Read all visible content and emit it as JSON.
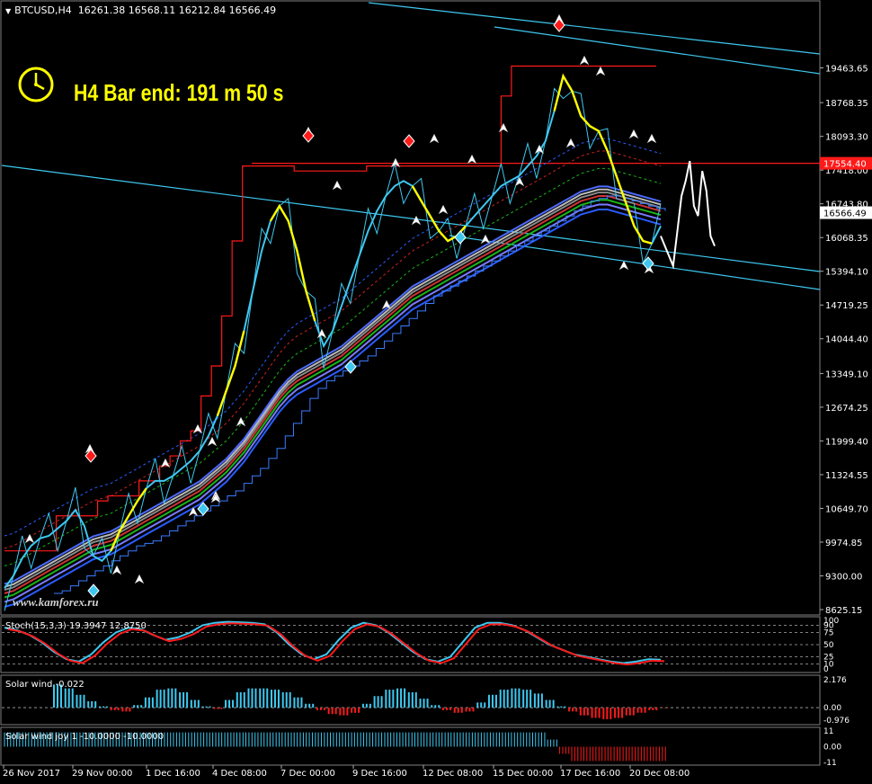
{
  "header": {
    "symbol_tf": "BTCUSD,H4",
    "ohlc": "16261.38 16568.11 16212.84 16566.49"
  },
  "bar_timer": "H4 Bar end: 191 m 50 s",
  "watermark": "www.kamforex.ru",
  "colors": {
    "bg": "#000000",
    "grid": "#3a3a3a",
    "red": "#ff1a1a",
    "cyan": "#3ec8f0",
    "yellow": "#ffff00",
    "white": "#ffffff",
    "blue": "#2a5cff",
    "green": "#19b419"
  },
  "chart_data": [
    {
      "type": "line",
      "title": "BTCUSD,H4",
      "ylim": [
        8625.15,
        20138.0
      ],
      "y_ticks": [
        "19463.65",
        "18768.35",
        "18093.30",
        "17418.00",
        "16743.80",
        "16068.35",
        "15394.10",
        "14719.25",
        "14044.40",
        "13349.10",
        "12674.25",
        "11999.40",
        "11324.55",
        "10649.70",
        "9974.85",
        "9300.00",
        "8625.15"
      ],
      "x_ticks": [
        "26 Nov 2017",
        "29 Nov 00:00",
        "1 Dec 16:00",
        "4 Dec 08:00",
        "7 Dec 00:00",
        "9 Dec 16:00",
        "12 Dec 08:00",
        "15 Dec 00:00",
        "17 Dec 16:00",
        "20 Dec 08:00"
      ],
      "current_price": "16566.49",
      "resistance_level": "17554.40",
      "series": [
        {
          "values": [
            9050,
            9300,
            9650,
            9900,
            10050,
            10100,
            10250,
            10400,
            10620,
            10300,
            9700,
            9600,
            9800,
            10200,
            10500,
            10800,
            11050,
            11200,
            11200,
            11300,
            11450,
            11600,
            11800,
            12100,
            12500,
            13000,
            13500,
            14200,
            15000,
            15800,
            16400,
            16700,
            16400,
            15800,
            15000,
            14400,
            13900,
            14200,
            14700,
            15200,
            15700,
            16200,
            16600,
            16900,
            17100,
            17200,
            17100,
            16800,
            16500,
            16200,
            16000,
            16100,
            16300,
            16500,
            16700,
            16900,
            17100,
            17200,
            17300,
            17500,
            17700,
            18000,
            18600,
            19300,
            19000,
            18500,
            18300,
            18200,
            17800,
            17300,
            16800,
            16300,
            16000,
            15950,
            16300
          ]
        },
        {
          "values": [
            9200,
            9250,
            9350,
            9450,
            9550,
            9650,
            9750,
            9850,
            9950,
            10050,
            10150,
            10200,
            10250,
            10350,
            10450,
            10550,
            10650,
            10750,
            10850,
            10950,
            11050,
            11150,
            11250,
            11400,
            11550,
            11700,
            11900,
            12100,
            12350,
            12600,
            12850,
            13100,
            13300,
            13450,
            13550,
            13650,
            13750,
            13850,
            13950,
            14100,
            14250,
            14400,
            14550,
            14700,
            14850,
            15000,
            15150,
            15250,
            15350,
            15450,
            15550,
            15650,
            15750,
            15850,
            15950,
            16050,
            16150,
            16250,
            16350,
            16450,
            16550,
            16650,
            16750,
            16850,
            16950,
            17050,
            17100,
            17150,
            17150,
            17100,
            17050,
            17000,
            16950,
            16900,
            16850
          ]
        },
        {
          "values": [
            9800,
            9800,
            9800,
            9800,
            9800,
            10500,
            10500,
            10500,
            10500,
            10800,
            10900,
            10900,
            10900,
            11200,
            11200,
            11500,
            11700,
            12000,
            12200,
            12900,
            13500,
            14500,
            16000,
            17500,
            17500,
            17500,
            17500,
            17500,
            17400,
            17400,
            17400,
            17400,
            17400,
            17400,
            17400,
            17500,
            17500,
            17500,
            17500,
            17500,
            17500,
            17500,
            17500,
            17500,
            17500,
            17500,
            17500,
            17500,
            18900,
            19500,
            19500,
            19500,
            19500,
            19500,
            19500,
            19500,
            19500,
            19500,
            19500,
            19500,
            19500,
            19500,
            19500,
            19500
          ]
        },
        {
          "values": [
            16100,
            15900,
            15700,
            15500,
            16200,
            16900,
            17200,
            17600,
            16700,
            16500,
            17400,
            17000,
            16100,
            15900
          ]
        }
      ]
    },
    {
      "type": "line",
      "title": "Stoch(15,3,3) 19.3947 12.8750",
      "ylim": [
        0,
        100
      ],
      "y_ticks": [
        "100",
        "90",
        "75",
        "50",
        "25",
        "10",
        "0"
      ],
      "series": [
        {
          "values": [
            85,
            80,
            70,
            55,
            35,
            20,
            15,
            30,
            55,
            75,
            85,
            82,
            70,
            60,
            65,
            75,
            90,
            95,
            97,
            96,
            95,
            92,
            75,
            50,
            30,
            20,
            30,
            60,
            85,
            95,
            90,
            75,
            55,
            35,
            20,
            15,
            25,
            55,
            85,
            95,
            95,
            90,
            80,
            65,
            50,
            40,
            30,
            25,
            20,
            15,
            12,
            15,
            20,
            19
          ]
        }
      ]
    },
    {
      "type": "bar",
      "title": "Solar wind -0.022",
      "ylim": [
        -0.976,
        2.176
      ],
      "y_ticks": [
        "2.176",
        "0.00",
        "-0.976"
      ],
      "series": [
        {
          "values": [
            1.8,
            1.5,
            1.0,
            0.5,
            0.1,
            -0.2,
            -0.3,
            0.2,
            0.8,
            1.4,
            1.5,
            1.2,
            0.6,
            0.1,
            -0.1,
            0.6,
            1.2,
            1.5,
            1.5,
            1.4,
            1.2,
            0.8,
            0.3,
            -0.2,
            -0.5,
            -0.6,
            -0.4,
            0.3,
            0.9,
            1.4,
            1.5,
            1.2,
            0.7,
            0.2,
            -0.2,
            -0.4,
            -0.3,
            0.4,
            1.0,
            1.4,
            1.5,
            1.4,
            1.1,
            0.6,
            0.1,
            -0.3,
            -0.6,
            -0.8,
            -0.9,
            -0.8,
            -0.6,
            -0.4,
            -0.2,
            -0.022
          ]
        }
      ]
    },
    {
      "type": "bar",
      "title": "Solar wind joy 1 -10.0000 -10.0000",
      "ylim": [
        -11,
        11
      ],
      "y_ticks": [
        "11",
        "0.00",
        "-11"
      ],
      "series": [
        {
          "values": [
            10,
            10,
            10,
            10,
            10,
            10,
            10,
            10,
            10,
            10,
            10,
            10,
            10,
            10,
            10,
            10,
            10,
            10,
            10,
            10,
            10,
            10,
            10,
            10,
            10,
            10,
            10,
            10,
            10,
            10,
            10,
            10,
            10,
            10,
            10,
            10,
            10,
            10,
            10,
            10,
            10,
            10,
            10,
            10,
            10,
            5,
            -5,
            -10,
            -10,
            -10,
            -10,
            -10,
            -10,
            -10,
            -10
          ]
        }
      ]
    }
  ]
}
